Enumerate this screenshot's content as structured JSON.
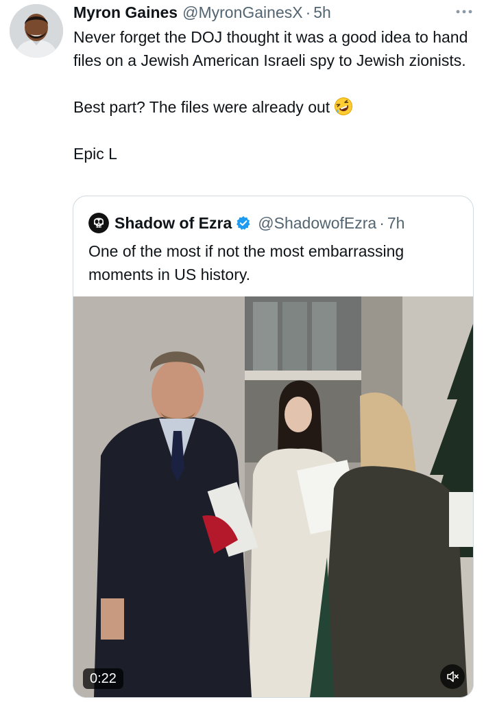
{
  "tweet": {
    "author_name": "Myron Gaines",
    "handle": "@MyronGainesX",
    "separator": "·",
    "time": "5h",
    "more_icon": "ellipsis-icon",
    "lines": [
      "Never forget the DOJ thought it was a good idea to hand files on a Jewish American Israeli spy to Jewish zionists.",
      "Best part? The files were already out",
      "Epic L"
    ],
    "emoji": "rolling-on-floor-laughing-emoji"
  },
  "quote": {
    "author_name": "Shadow of Ezra",
    "verified_icon": "verified-badge-icon",
    "handle": "@ShadowofEzra",
    "separator": "·",
    "time": "7h",
    "text": "One of the most if not the most embarrassing moments in US history.",
    "video": {
      "duration": "0:22",
      "mute_icon": "speaker-muted-icon"
    }
  },
  "colors": {
    "text": "#0f1419",
    "muted": "#536471",
    "border": "#cfd9de",
    "verified": "#1d9bf0"
  }
}
